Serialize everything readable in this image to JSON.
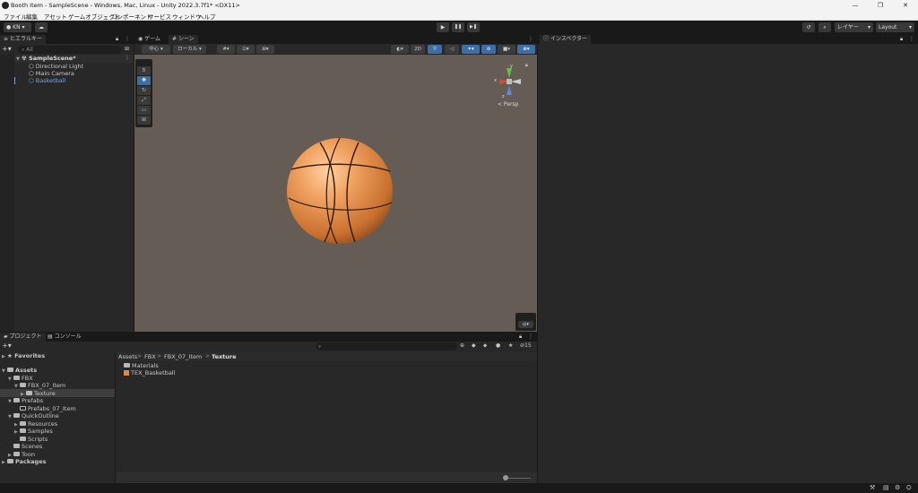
{
  "window": {
    "title": "Booth Item - SampleScene - Windows, Mac, Linux - Unity 2022.3.7f1* <DX11>",
    "controls": [
      "—",
      "❐",
      "✕"
    ]
  },
  "menu": [
    "ファイル",
    "編集",
    "アセット",
    "ゲームオブジェクト",
    "コンポーネント",
    "サービス",
    "ウィンドウ",
    "ヘルプ"
  ],
  "toolbar": {
    "account": "KN ▾",
    "play_icons": [
      "▶",
      "❚❚",
      "▶❚"
    ],
    "layer_dropdown": "レイヤー",
    "layout_dropdown": "Layout"
  },
  "hierarchy": {
    "tab": "ヒエラルキー",
    "search_placeholder": "All",
    "items": [
      {
        "label": "SampleScene*"
      },
      {
        "label": "Directional Light"
      },
      {
        "label": "Main Camera"
      },
      {
        "label": "Basketball"
      }
    ]
  },
  "scene": {
    "tabs": [
      "ゲーム",
      "シーン"
    ],
    "pivot_dropdown": "中心",
    "space_dropdown": "ローカル",
    "mode_2d": "2D",
    "persp_label": "< Persp",
    "gizmo_axes": {
      "y": "y",
      "x": "x",
      "z": "z"
    }
  },
  "inspector": {
    "tab": "インスペクター"
  },
  "project": {
    "tabs": [
      "プロジェクト",
      "コンソール"
    ],
    "hidden_count": "15",
    "breadcrumb": [
      "Assets",
      "FBX",
      "FBX_07_Item",
      "Texture"
    ],
    "tree": [
      {
        "label": "Favorites"
      },
      {
        "label": "Assets"
      },
      {
        "label": "FBX"
      },
      {
        "label": "FBX_07_Item"
      },
      {
        "label": "Texture"
      },
      {
        "label": "Prefabs"
      },
      {
        "label": "Prefabs_07_Item"
      },
      {
        "label": "QuickOutline"
      },
      {
        "label": "Resources"
      },
      {
        "label": "Samples"
      },
      {
        "label": "Scripts"
      },
      {
        "label": "Scenes"
      },
      {
        "label": "Toon"
      },
      {
        "label": "Packages"
      }
    ],
    "files": [
      {
        "label": "Materials"
      },
      {
        "label": "TEX_Basketball"
      }
    ]
  },
  "colors": {
    "accent": "#3d6fa6",
    "scene_bg": "#655c56",
    "ball": "#e08a45"
  }
}
